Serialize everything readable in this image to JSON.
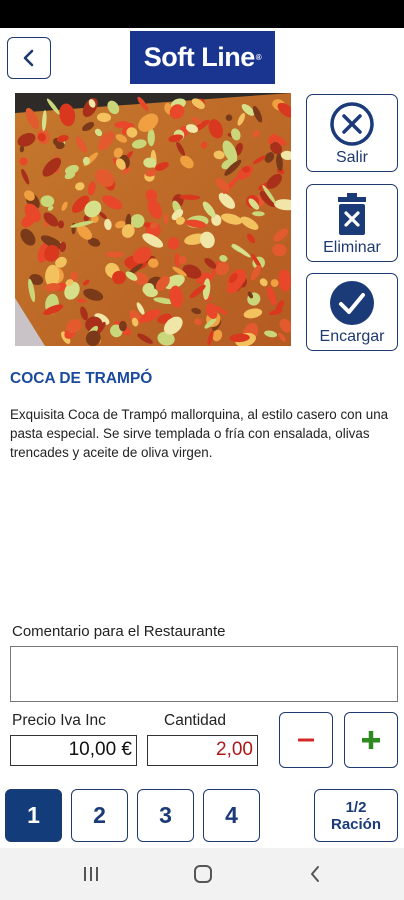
{
  "header": {
    "brand": "Soft Line",
    "brand_mark": "®"
  },
  "actions": {
    "exit_label": "Salir",
    "delete_label": "Eliminar",
    "order_label": "Encargar"
  },
  "product": {
    "title": "COCA DE TRAMPÓ",
    "description": "Exquisita Coca de Trampó mallorquina, al estilo casero con una pasta especial. Se sirve templada o fría con ensalada, olivas trencades y aceite de oliva virgen.",
    "image": "coca-de-trampo-photo"
  },
  "form": {
    "comment_label": "Comentario para el Restaurante",
    "comment_value": "",
    "price_label": "Precio Iva Inc",
    "price_value": "10,00 €",
    "qty_label": "Cantidad",
    "qty_value": "2,00"
  },
  "quantity_buttons": [
    "1",
    "2",
    "3",
    "4"
  ],
  "active_quantity": "1",
  "half_ration": {
    "line1": "1/2",
    "line2": "Ración"
  },
  "icons": {
    "back": "chevron-left-icon",
    "exit": "close-circle-icon",
    "delete": "trash-icon",
    "order": "check-circle-icon",
    "minus": "minus-icon",
    "plus": "plus-icon"
  },
  "colors": {
    "brand": "#1a3590",
    "accent": "#1e3a6e",
    "active": "#133d7a",
    "title": "#1a4a9e",
    "minus": "#d62828",
    "plus": "#2e8b1f",
    "qty_text": "#b01818"
  }
}
